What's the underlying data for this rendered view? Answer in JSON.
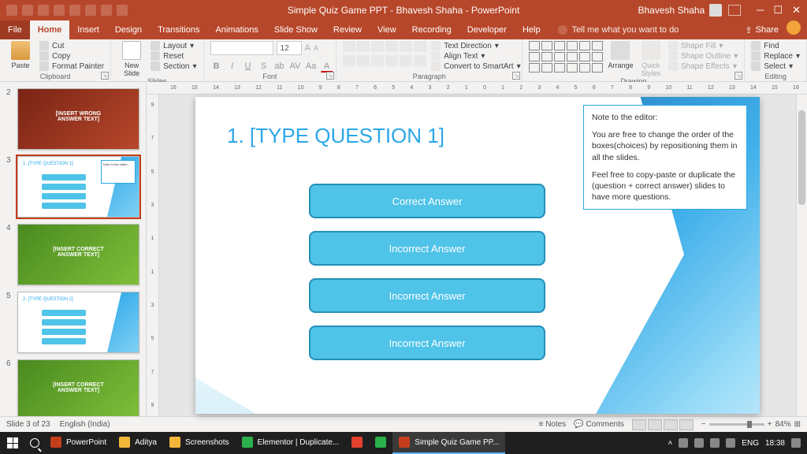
{
  "titlebar": {
    "title": "Simple Quiz Game PPT - Bhavesh Shaha  -  PowerPoint",
    "user": "Bhavesh Shaha"
  },
  "tabs": {
    "file": "File",
    "home": "Home",
    "insert": "Insert",
    "design": "Design",
    "transitions": "Transitions",
    "animations": "Animations",
    "slideshow": "Slide Show",
    "review": "Review",
    "view": "View",
    "recording": "Recording",
    "developer": "Developer",
    "help": "Help",
    "tellme": "Tell me what you want to do",
    "share": "Share"
  },
  "ribbon": {
    "clipboard": {
      "paste": "Paste",
      "cut": "Cut",
      "copy": "Copy",
      "format_painter": "Format Painter",
      "label": "Clipboard"
    },
    "slides": {
      "new_slide": "New\nSlide",
      "layout": "Layout",
      "reset": "Reset",
      "section": "Section",
      "label": "Slides"
    },
    "font": {
      "label": "Font",
      "size": "12"
    },
    "paragraph": {
      "td": "Text Direction",
      "align": "Align Text",
      "smartart": "Convert to SmartArt",
      "label": "Paragraph"
    },
    "drawing": {
      "arrange": "Arrange",
      "quick": "Quick\nStyles",
      "fill": "Shape Fill",
      "outline": "Shape Outline",
      "effects": "Shape Effects",
      "label": "Drawing"
    },
    "editing": {
      "find": "Find",
      "replace": "Replace",
      "select": "Select",
      "label": "Editing"
    }
  },
  "thumbs": [
    {
      "n": "2",
      "title": "[INSERT WRONG\nANSWER TEXT]",
      "bg": "linear-gradient(135deg,#7a2415,#b7472a)"
    },
    {
      "n": "3",
      "title": "1. [TYPE QUESTION 1]",
      "bg": "#fff",
      "selected": true
    },
    {
      "n": "4",
      "title": "[INSERT CORRECT\nANSWER TEXT]",
      "bg": "linear-gradient(135deg,#4a8a1f,#7fbf3a)"
    },
    {
      "n": "5",
      "title": "2. [TYPE QUESTION 2]",
      "bg": "#fff"
    },
    {
      "n": "6",
      "title": "[INSERT CORRECT\nANSWER TEXT]",
      "bg": "linear-gradient(135deg,#4a8a1f,#7fbf3a)"
    }
  ],
  "slide": {
    "title": "1. [TYPE QUESTION 1]",
    "answers": [
      "Correct Answer",
      "Incorrect Answer",
      "Incorrect Answer",
      "Incorrect Answer"
    ],
    "note_heading": "Note to the editor:",
    "note_p1": "You are free to change the order of the boxes(choices) by repositioning them in all the slides.",
    "note_p2": "Feel free to copy-paste or duplicate the (question + correct answer) slides to have more questions."
  },
  "ruler_h": [
    "16",
    "15",
    "14",
    "13",
    "12",
    "11",
    "10",
    "9",
    "8",
    "7",
    "6",
    "5",
    "4",
    "3",
    "2",
    "1",
    "0",
    "1",
    "2",
    "3",
    "4",
    "5",
    "6",
    "7",
    "8",
    "9",
    "10",
    "11",
    "12",
    "13",
    "14",
    "15",
    "16"
  ],
  "ruler_v": [
    "9",
    "7",
    "5",
    "3",
    "1",
    "1",
    "3",
    "5",
    "7",
    "9"
  ],
  "status": {
    "slide": "Slide 3 of 23",
    "lang": "English (India)",
    "notes": "Notes",
    "comments": "Comments",
    "zoom": "84%"
  },
  "taskbar": {
    "items": [
      {
        "label": "PowerPoint",
        "color": "#C43E1C"
      },
      {
        "label": "Aditya",
        "color": "#f2b63a"
      },
      {
        "label": "Screenshots",
        "color": "#f2b63a"
      },
      {
        "label": "Elementor | Duplicate...",
        "color": "#2bb14c"
      },
      {
        "label": "",
        "color": "#e3402d"
      },
      {
        "label": "",
        "color": "#2bb14c"
      },
      {
        "label": "Simple Quiz Game PP...",
        "color": "#C43E1C",
        "active": true
      }
    ],
    "lang": "ENG",
    "time": "18:38"
  }
}
